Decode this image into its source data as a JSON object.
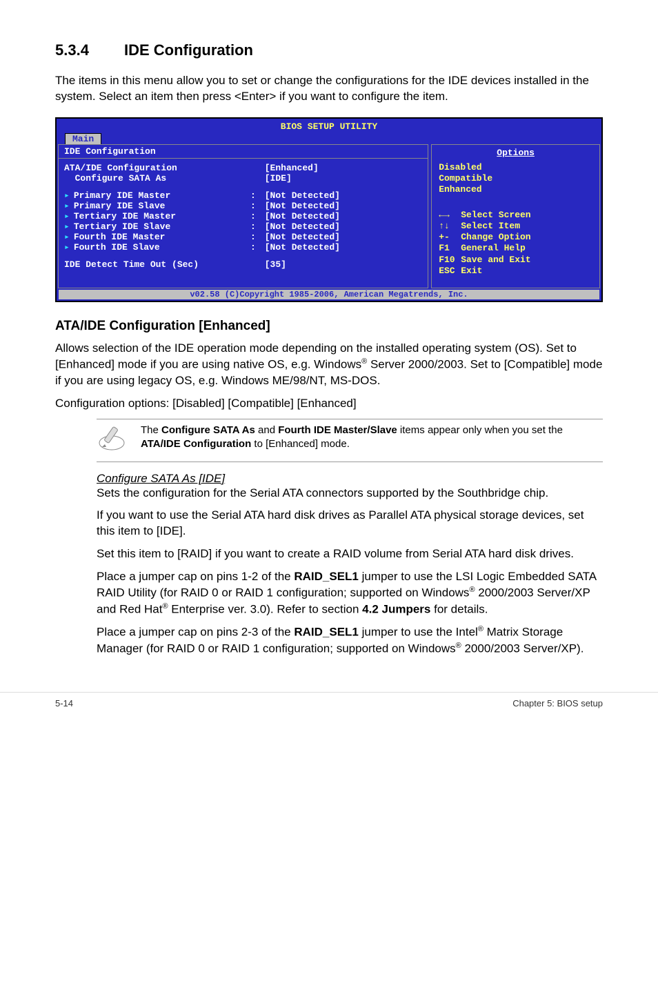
{
  "section": {
    "number": "5.3.4",
    "title": "IDE Configuration",
    "intro": "The items in this menu allow you to set or change the configurations for the IDE devices installed in the system. Select an item then press <Enter> if you want to configure the item."
  },
  "bios": {
    "title": "BIOS SETUP UTILITY",
    "tab": "Main",
    "left_header": "IDE Configuration",
    "settings": [
      {
        "label": "ATA/IDE Configuration",
        "value": "[Enhanced]"
      },
      {
        "label": "  Configure SATA As",
        "value": "[IDE]"
      }
    ],
    "devices": [
      {
        "label": "Primary IDE Master",
        "value": "[Not Detected]"
      },
      {
        "label": "Primary IDE Slave",
        "value": "[Not Detected]"
      },
      {
        "label": "Tertiary IDE Master",
        "value": "[Not Detected]"
      },
      {
        "label": "Tertiary IDE Slave",
        "value": "[Not Detected]"
      },
      {
        "label": "Fourth IDE Master",
        "value": "[Not Detected]"
      },
      {
        "label": "Fourth IDE Slave",
        "value": "[Not Detected]"
      }
    ],
    "last": {
      "label": "IDE Detect Time Out (Sec)",
      "value": "[35]"
    },
    "options_header": "Options",
    "options": [
      "Disabled",
      "Compatible",
      "Enhanced"
    ],
    "help": [
      {
        "key": "←→",
        "text": "Select Screen"
      },
      {
        "key": "↑↓",
        "text": "Select Item"
      },
      {
        "key": "+-",
        "text": "Change Option"
      },
      {
        "key": "F1",
        "text": "General Help"
      },
      {
        "key": "F10",
        "text": "Save and Exit"
      },
      {
        "key": "ESC",
        "text": "Exit"
      }
    ],
    "footer": "v02.58 (C)Copyright 1985-2006, American Megatrends, Inc."
  },
  "ata": {
    "title": "ATA/IDE Configuration [Enhanced]",
    "p1a": "Allows selection of the IDE operation mode depending on the installed operating system (OS). Set to [Enhanced] mode if you are using native OS, e.g. Windows",
    "p1b": " Server 2000/2003. Set to [Compatible] mode if you are using legacy OS, e.g. Windows ME/98/NT, MS-DOS.",
    "p2": "Configuration options: [Disabled] [Compatible] [Enhanced]"
  },
  "note": {
    "t1": "The ",
    "b1": "Configure SATA As",
    "t2": " and ",
    "b2": "Fourth IDE Master/Slave",
    "t3": " items appear only when you set the ",
    "b3": "ATA/IDE Configuration",
    "t4": " to [Enhanced] mode."
  },
  "sata": {
    "title": "Configure SATA As [IDE]",
    "p1": "Sets the configuration for the Serial ATA connectors supported by the Southbridge chip.",
    "p2": "If you want to use the Serial ATA hard disk drives as Parallel ATA physical storage devices, set this item to [IDE].",
    "p3": "Set this item to [RAID] if you want to create a RAID volume from Serial ATA hard disk drives.",
    "p4a": "Place a jumper cap on pins 1-2 of the ",
    "p4b": "RAID_SEL1",
    "p4c": " jumper to use the LSI Logic Embedded SATA RAID Utility (for RAID 0 or RAID 1 configuration; supported on Windows",
    "p4d": " 2000/2003 Server/XP and Red Hat",
    "p4e": " Enterprise ver. 3.0). Refer to section ",
    "p4f": "4.2 Jumpers",
    "p4g": " for details.",
    "p5a": "Place a jumper cap on pins 2-3 of the ",
    "p5b": "RAID_SEL1",
    "p5c": " jumper to use the Intel",
    "p5d": " Matrix Storage Manager (for RAID 0 or RAID 1 configuration; supported on Windows",
    "p5e": " 2000/2003 Server/XP)."
  },
  "footer": {
    "left": "5-14",
    "right": "Chapter 5: BIOS setup"
  }
}
